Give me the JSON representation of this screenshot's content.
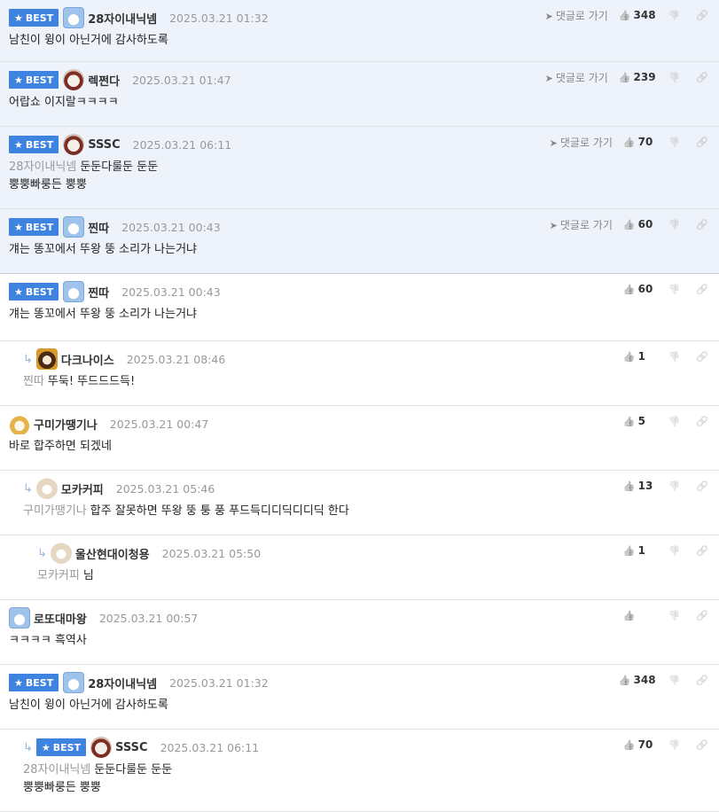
{
  "common": {
    "best_label": "BEST",
    "goto_label": "댓글로 가기"
  },
  "comments": [
    {
      "best": true,
      "top": true,
      "nick": "28자이내닉넴",
      "date": "2025.03.21 01:32",
      "mention": "",
      "lines": [
        "남친이 윙이 아닌거에 감사하도록"
      ],
      "likes": "348",
      "goto": true,
      "avatar": "blue",
      "indent": 0
    },
    {
      "best": true,
      "top": true,
      "nick": "렉쩐다",
      "date": "2025.03.21 01:47",
      "mention": "",
      "lines": [
        "어랍쇼 이지랄ㅋㅋㅋㅋ"
      ],
      "likes": "239",
      "goto": true,
      "avatar": "pup",
      "indent": 0
    },
    {
      "best": true,
      "top": true,
      "nick": "SSSC",
      "date": "2025.03.21 06:11",
      "mention": "28자이내닉넴",
      "lines": [
        "둔둔다룰둔 둔둔",
        "뿡뿡빠룽든 뿡뿡"
      ],
      "likes": "70",
      "goto": true,
      "avatar": "pup",
      "indent": 0
    },
    {
      "best": true,
      "top": true,
      "nick": "찐따",
      "date": "2025.03.21 00:43",
      "mention": "",
      "lines": [
        "걔는 똥꼬에서 뚜왕 뚱 소리가 나는거냐"
      ],
      "likes": "60",
      "goto": true,
      "avatar": "blue",
      "indent": 0
    },
    {
      "best": true,
      "top": false,
      "nick": "찐따",
      "date": "2025.03.21 00:43",
      "mention": "",
      "lines": [
        "걔는 똥꼬에서 뚜왕 뚱 소리가 나는거냐"
      ],
      "likes": "60",
      "goto": false,
      "avatar": "blue",
      "indent": 0
    },
    {
      "best": false,
      "top": false,
      "nick": "다크나이스",
      "date": "2025.03.21 08:46",
      "mention": "찐따",
      "lines": [
        "뚜둑! 뚜드드드득!"
      ],
      "likes": "1",
      "goto": false,
      "avatar": "dark",
      "indent": 1
    },
    {
      "best": false,
      "top": false,
      "nick": "구미가땡기나",
      "date": "2025.03.21 00:47",
      "mention": "",
      "lines": [
        "바로 합주하면 되겠네"
      ],
      "likes": "5",
      "goto": false,
      "avatar": "fox",
      "indent": 0
    },
    {
      "best": false,
      "top": false,
      "nick": "모카커피",
      "date": "2025.03.21 05:46",
      "mention": "구미가땡기나",
      "lines": [
        "합주 잘못하면 뚜왕 뚱 퉁 풍 푸드득디디딕디디딕 한다"
      ],
      "likes": "13",
      "goto": false,
      "avatar": "beige",
      "indent": 1
    },
    {
      "best": false,
      "top": false,
      "nick": "울산현대이청용",
      "date": "2025.03.21 05:50",
      "mention": "모카커피",
      "lines": [
        "님"
      ],
      "likes": "1",
      "goto": false,
      "avatar": "beige",
      "indent": 2
    },
    {
      "best": false,
      "top": false,
      "nick": "로또대마왕",
      "date": "2025.03.21 00:57",
      "mention": "",
      "lines": [
        "ㅋㅋㅋㅋ 흑역사"
      ],
      "likes": "",
      "goto": false,
      "avatar": "blue",
      "indent": 0
    },
    {
      "best": true,
      "top": false,
      "nick": "28자이내닉넴",
      "date": "2025.03.21 01:32",
      "mention": "",
      "lines": [
        "남친이 윙이 아닌거에 감사하도록"
      ],
      "likes": "348",
      "goto": false,
      "avatar": "blue",
      "indent": 0
    },
    {
      "best": true,
      "top": false,
      "nick": "SSSC",
      "date": "2025.03.21 06:11",
      "mention": "28자이내닉넴",
      "lines": [
        "둔둔다룰둔 둔둔",
        "뿡뿡빠룽든 뿡뿡"
      ],
      "likes": "70",
      "goto": false,
      "avatar": "pup",
      "indent": 1
    }
  ]
}
